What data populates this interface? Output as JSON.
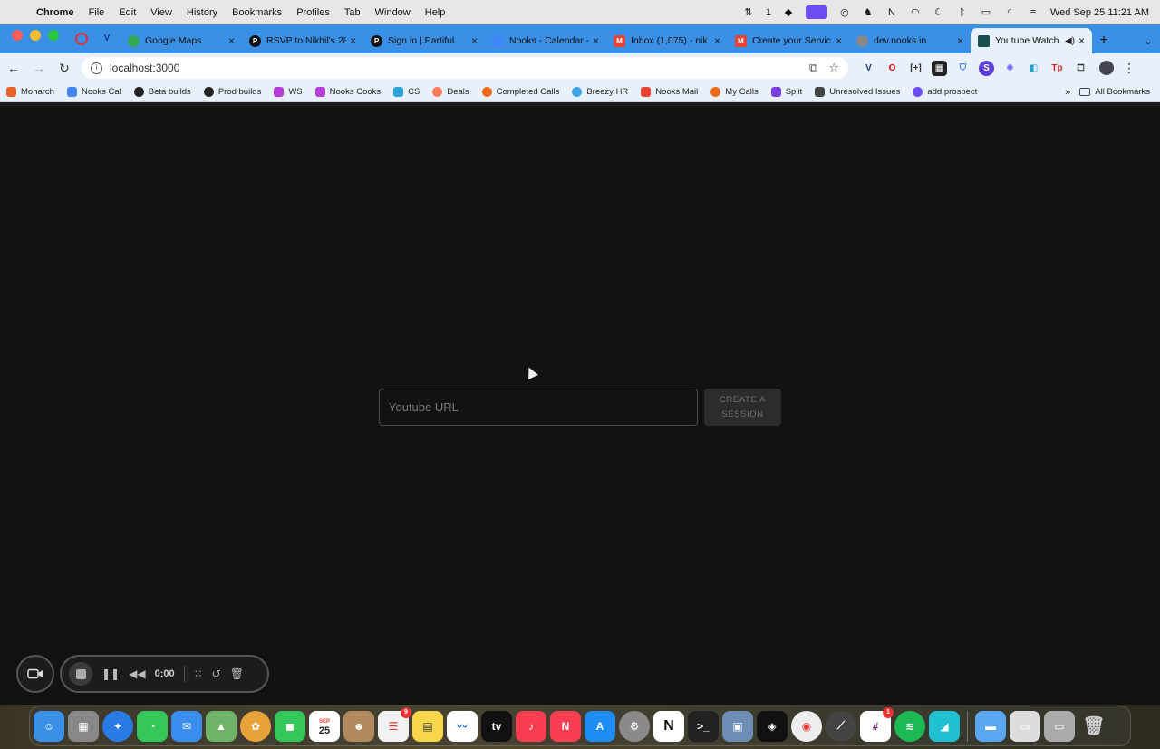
{
  "menubar": {
    "app_name": "Chrome",
    "items": [
      "File",
      "Edit",
      "View",
      "History",
      "Bookmarks",
      "Profiles",
      "Tab",
      "Window",
      "Help"
    ],
    "status_count": "1",
    "datetime": "Wed Sep 25  11:21 AM"
  },
  "tabs": [
    {
      "title": "Google Maps",
      "color": "#34a853"
    },
    {
      "title": "RSVP to Nikhil's 28",
      "color": "#111111"
    },
    {
      "title": "Sign in | Partiful",
      "color": "#111111"
    },
    {
      "title": "Nooks - Calendar -",
      "color": "#4285f4"
    },
    {
      "title": "Inbox (1,075) - nik",
      "color": "#ea4335"
    },
    {
      "title": "Create your Servic",
      "color": "#ea4335"
    },
    {
      "title": "dev.nooks.in",
      "color": "#888888"
    },
    {
      "title": "Youtube Watch",
      "color": "#1a4f4f"
    }
  ],
  "toolbar": {
    "url": "localhost:3000"
  },
  "bookmarks": {
    "items": [
      "Monarch",
      "Nooks Cal",
      "Beta builds",
      "Prod builds",
      "WS",
      "Nooks Cooks",
      "CS",
      "Deals",
      "Completed Calls",
      "Breezy HR",
      "Nooks Mail",
      "My Calls",
      "Split",
      "Unresolved Issues",
      "add prospect"
    ],
    "all_label": "All Bookmarks"
  },
  "page": {
    "input_placeholder": "Youtube URL",
    "create_label": "CREATE A SESSION"
  },
  "recorder": {
    "time": "0:00"
  },
  "dock": {
    "calendar_month": "SEP",
    "calendar_day": "25",
    "reminders_badge": "9",
    "slack_badge": "1"
  }
}
